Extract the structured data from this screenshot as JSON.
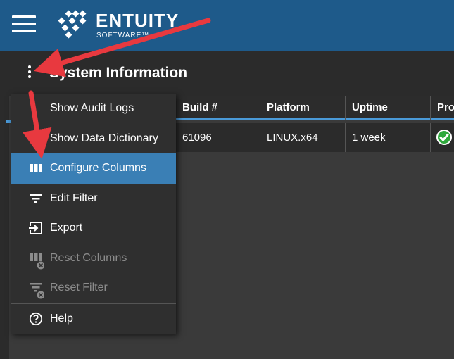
{
  "header": {
    "brand": "ENTUITY",
    "brand_sub": "SOFTWARE™"
  },
  "page": {
    "title": "System Information"
  },
  "table": {
    "columns": [
      "Build #",
      "Platform",
      "Uptime",
      "Proc"
    ],
    "rows": [
      {
        "build": "61096",
        "platform": "LINUX.x64",
        "uptime": "1 week",
        "proc": "check"
      }
    ]
  },
  "menu": {
    "items": [
      {
        "label": "Show Audit Logs",
        "icon": "none",
        "state": "normal"
      },
      {
        "label": "Show Data Dictionary",
        "icon": "none",
        "state": "normal"
      },
      {
        "label": "Configure Columns",
        "icon": "columns-icon",
        "state": "highlighted"
      },
      {
        "label": "Edit Filter",
        "icon": "filter-icon",
        "state": "normal"
      },
      {
        "label": "Export",
        "icon": "export-icon",
        "state": "normal"
      },
      {
        "label": "Reset Columns",
        "icon": "reset-columns-icon",
        "state": "disabled"
      },
      {
        "label": "Reset Filter",
        "icon": "reset-filter-icon",
        "state": "disabled"
      },
      {
        "label": "Help",
        "icon": "help-icon",
        "state": "normal"
      }
    ]
  },
  "colors": {
    "header_bg": "#1e5a8a",
    "highlight": "#3a7fb5",
    "annotation_arrow": "#e8393f",
    "status_ok": "#2ea83c"
  }
}
